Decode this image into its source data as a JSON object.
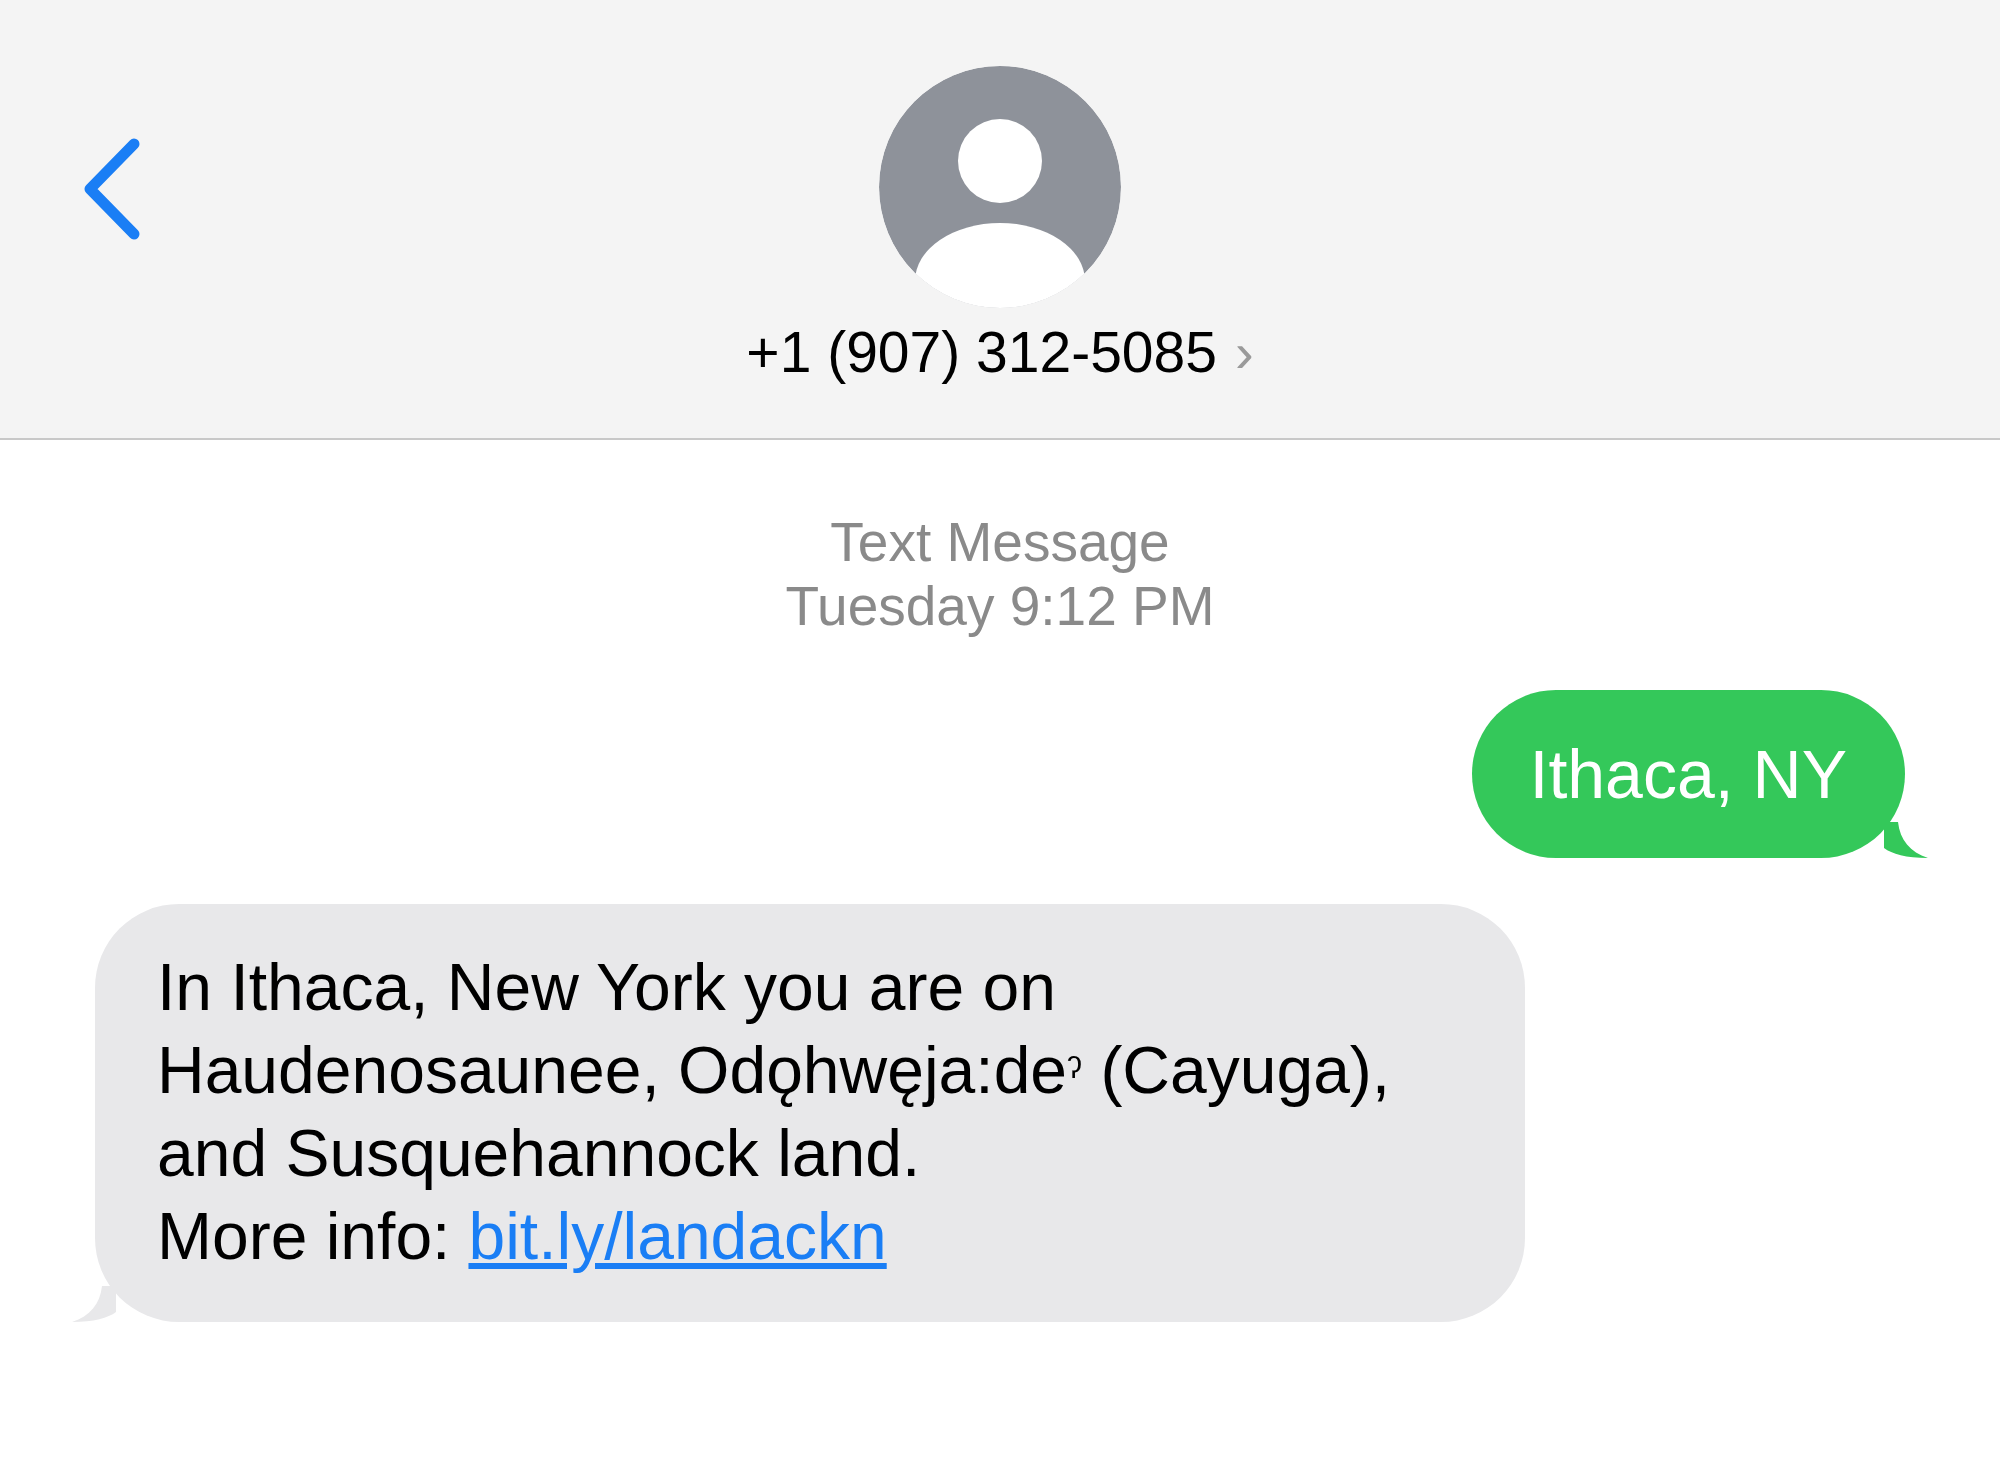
{
  "header": {
    "contact": "+1 (907) 312-5085",
    "chevron": "›"
  },
  "conversation_header": {
    "service": "Text Message",
    "timestamp": "Tuesday 9:12 PM"
  },
  "messages": [
    {
      "kind": "sent",
      "text": "Ithaca, NY"
    },
    {
      "kind": "received",
      "text": "In Ithaca, New York you are on Haudenosaunee, Odǫhwęja:de$^{ʔ}$ (Cayuga), and Susquehannock land.",
      "more_info": "More info:",
      "link": "bit.ly/landackn"
    }
  ]
}
